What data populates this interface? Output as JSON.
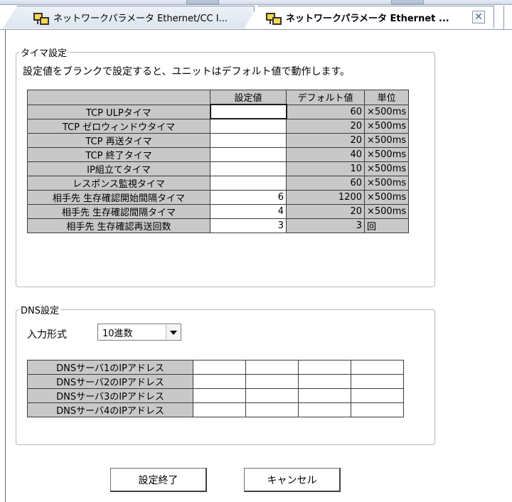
{
  "tabs": [
    {
      "label": "ネットワークパラメータ Ethernet/CC I...",
      "active": false
    },
    {
      "label": "ネットワークパラメータ Ethernet ...",
      "active": true,
      "close": "✕"
    }
  ],
  "timer": {
    "legend": "タイマ設定",
    "note": "設定値をブランクで設定すると、ユニットはデフォルト値で動作します。",
    "headers": [
      "",
      "設定値",
      "デフォルト値",
      "単位"
    ],
    "rows": [
      {
        "label": "TCP ULPタイマ",
        "value": "",
        "default": "60",
        "unit": "×500ms"
      },
      {
        "label": "TCP ゼロウィンドウタイマ",
        "value": "",
        "default": "20",
        "unit": "×500ms"
      },
      {
        "label": "TCP 再送タイマ",
        "value": "",
        "default": "20",
        "unit": "×500ms"
      },
      {
        "label": "TCP 終了タイマ",
        "value": "",
        "default": "40",
        "unit": "×500ms"
      },
      {
        "label": "IP組立てタイマ",
        "value": "",
        "default": "10",
        "unit": "×500ms"
      },
      {
        "label": "レスポンス監視タイマ",
        "value": "",
        "default": "60",
        "unit": "×500ms"
      },
      {
        "label": "相手先 生存確認開始間隔タイマ",
        "value": "6",
        "default": "1200",
        "unit": "×500ms"
      },
      {
        "label": "相手先 生存確認間隔タイマ",
        "value": "4",
        "default": "20",
        "unit": "×500ms"
      },
      {
        "label": "相手先 生存確認再送回数",
        "value": "3",
        "default": "3",
        "unit": "回"
      }
    ]
  },
  "dns": {
    "legend": "DNS設定",
    "input_format_label": "入力形式",
    "input_format_value": "10進数",
    "servers": [
      {
        "label": "DNSサーバ1のIPアドレス",
        "octets": [
          "",
          "",
          "",
          ""
        ]
      },
      {
        "label": "DNSサーバ2のIPアドレス",
        "octets": [
          "",
          "",
          "",
          ""
        ]
      },
      {
        "label": "DNSサーバ3のIPアドレス",
        "octets": [
          "",
          "",
          "",
          ""
        ]
      },
      {
        "label": "DNSサーバ4のIPアドレス",
        "octets": [
          "",
          "",
          "",
          ""
        ]
      }
    ]
  },
  "buttons": {
    "ok": "設定終了",
    "cancel": "キャンセル"
  },
  "icons": {
    "tab": "network-module-icon",
    "close": "close-icon",
    "dropdown": "chevron-down-icon"
  }
}
